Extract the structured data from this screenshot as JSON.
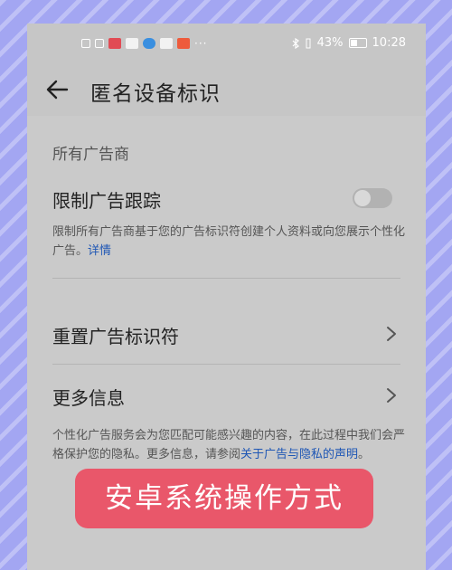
{
  "status_bar": {
    "icons": [
      "hd-icon",
      "signal-icon",
      "red-app-icon",
      "chat-icon",
      "browser-icon",
      "mail-icon",
      "news-app-icon"
    ],
    "more": "···",
    "battery_percent": "43%",
    "time": "10:28"
  },
  "header": {
    "back_icon": "back-arrow-icon",
    "title": "匿名设备标识"
  },
  "section": {
    "title": "所有广告商"
  },
  "limit_tracking": {
    "label": "限制广告跟踪",
    "enabled": false,
    "desc": "限制所有广告商基于您的广告标识符创建个人资料或向您展示个性化广告。",
    "details_link": "详情"
  },
  "reset_id": {
    "label": "重置广告标识符",
    "icon": "chevron-right-icon"
  },
  "more_info": {
    "label": "更多信息",
    "icon": "chevron-right-icon"
  },
  "privacy_note": {
    "text": "个性化广告服务会为您匹配可能感兴趣的内容，在此过程中我们会严格保护您的隐私。更多信息，请参阅",
    "link": "关于广告与隐私的声明",
    "suffix": "。"
  },
  "banner": {
    "text": "安卓系统操作方式"
  },
  "colors": {
    "background": "#a3a6f2",
    "screen": "#c6c6c6",
    "link": "#1f57b5",
    "banner": "#e9576a"
  }
}
